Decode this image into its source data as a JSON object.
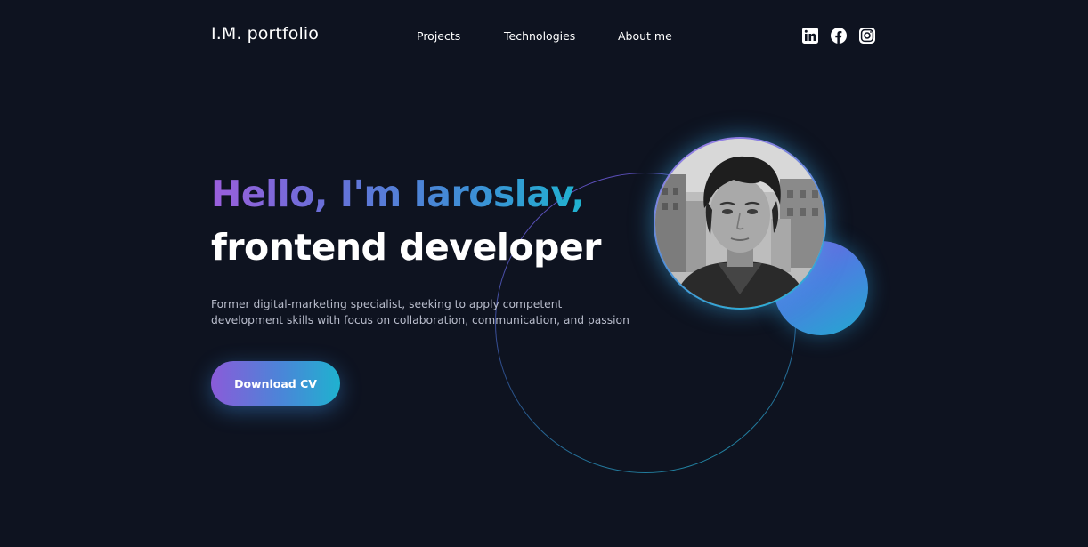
{
  "header": {
    "logo": "I.M. portfolio",
    "nav": [
      {
        "label": "Projects"
      },
      {
        "label": "Technologies"
      },
      {
        "label": "About me"
      }
    ],
    "social_icons": [
      "linkedin-icon",
      "facebook-icon",
      "instagram-icon"
    ]
  },
  "hero": {
    "greeting": "Hello, I'm Iaroslav,",
    "role": "frontend developer",
    "description_lines": [
      "Former digital-marketing specialist, seeking to apply competent",
      "development skills with focus on collaboration, communication, and passion"
    ],
    "cta_label": "Download CV"
  },
  "colors": {
    "background": "#0e1320",
    "gradient_start": "#9b5fdc",
    "gradient_end": "#1fb3cf",
    "text_primary": "#ffffff",
    "text_secondary": "#b8bccb"
  }
}
